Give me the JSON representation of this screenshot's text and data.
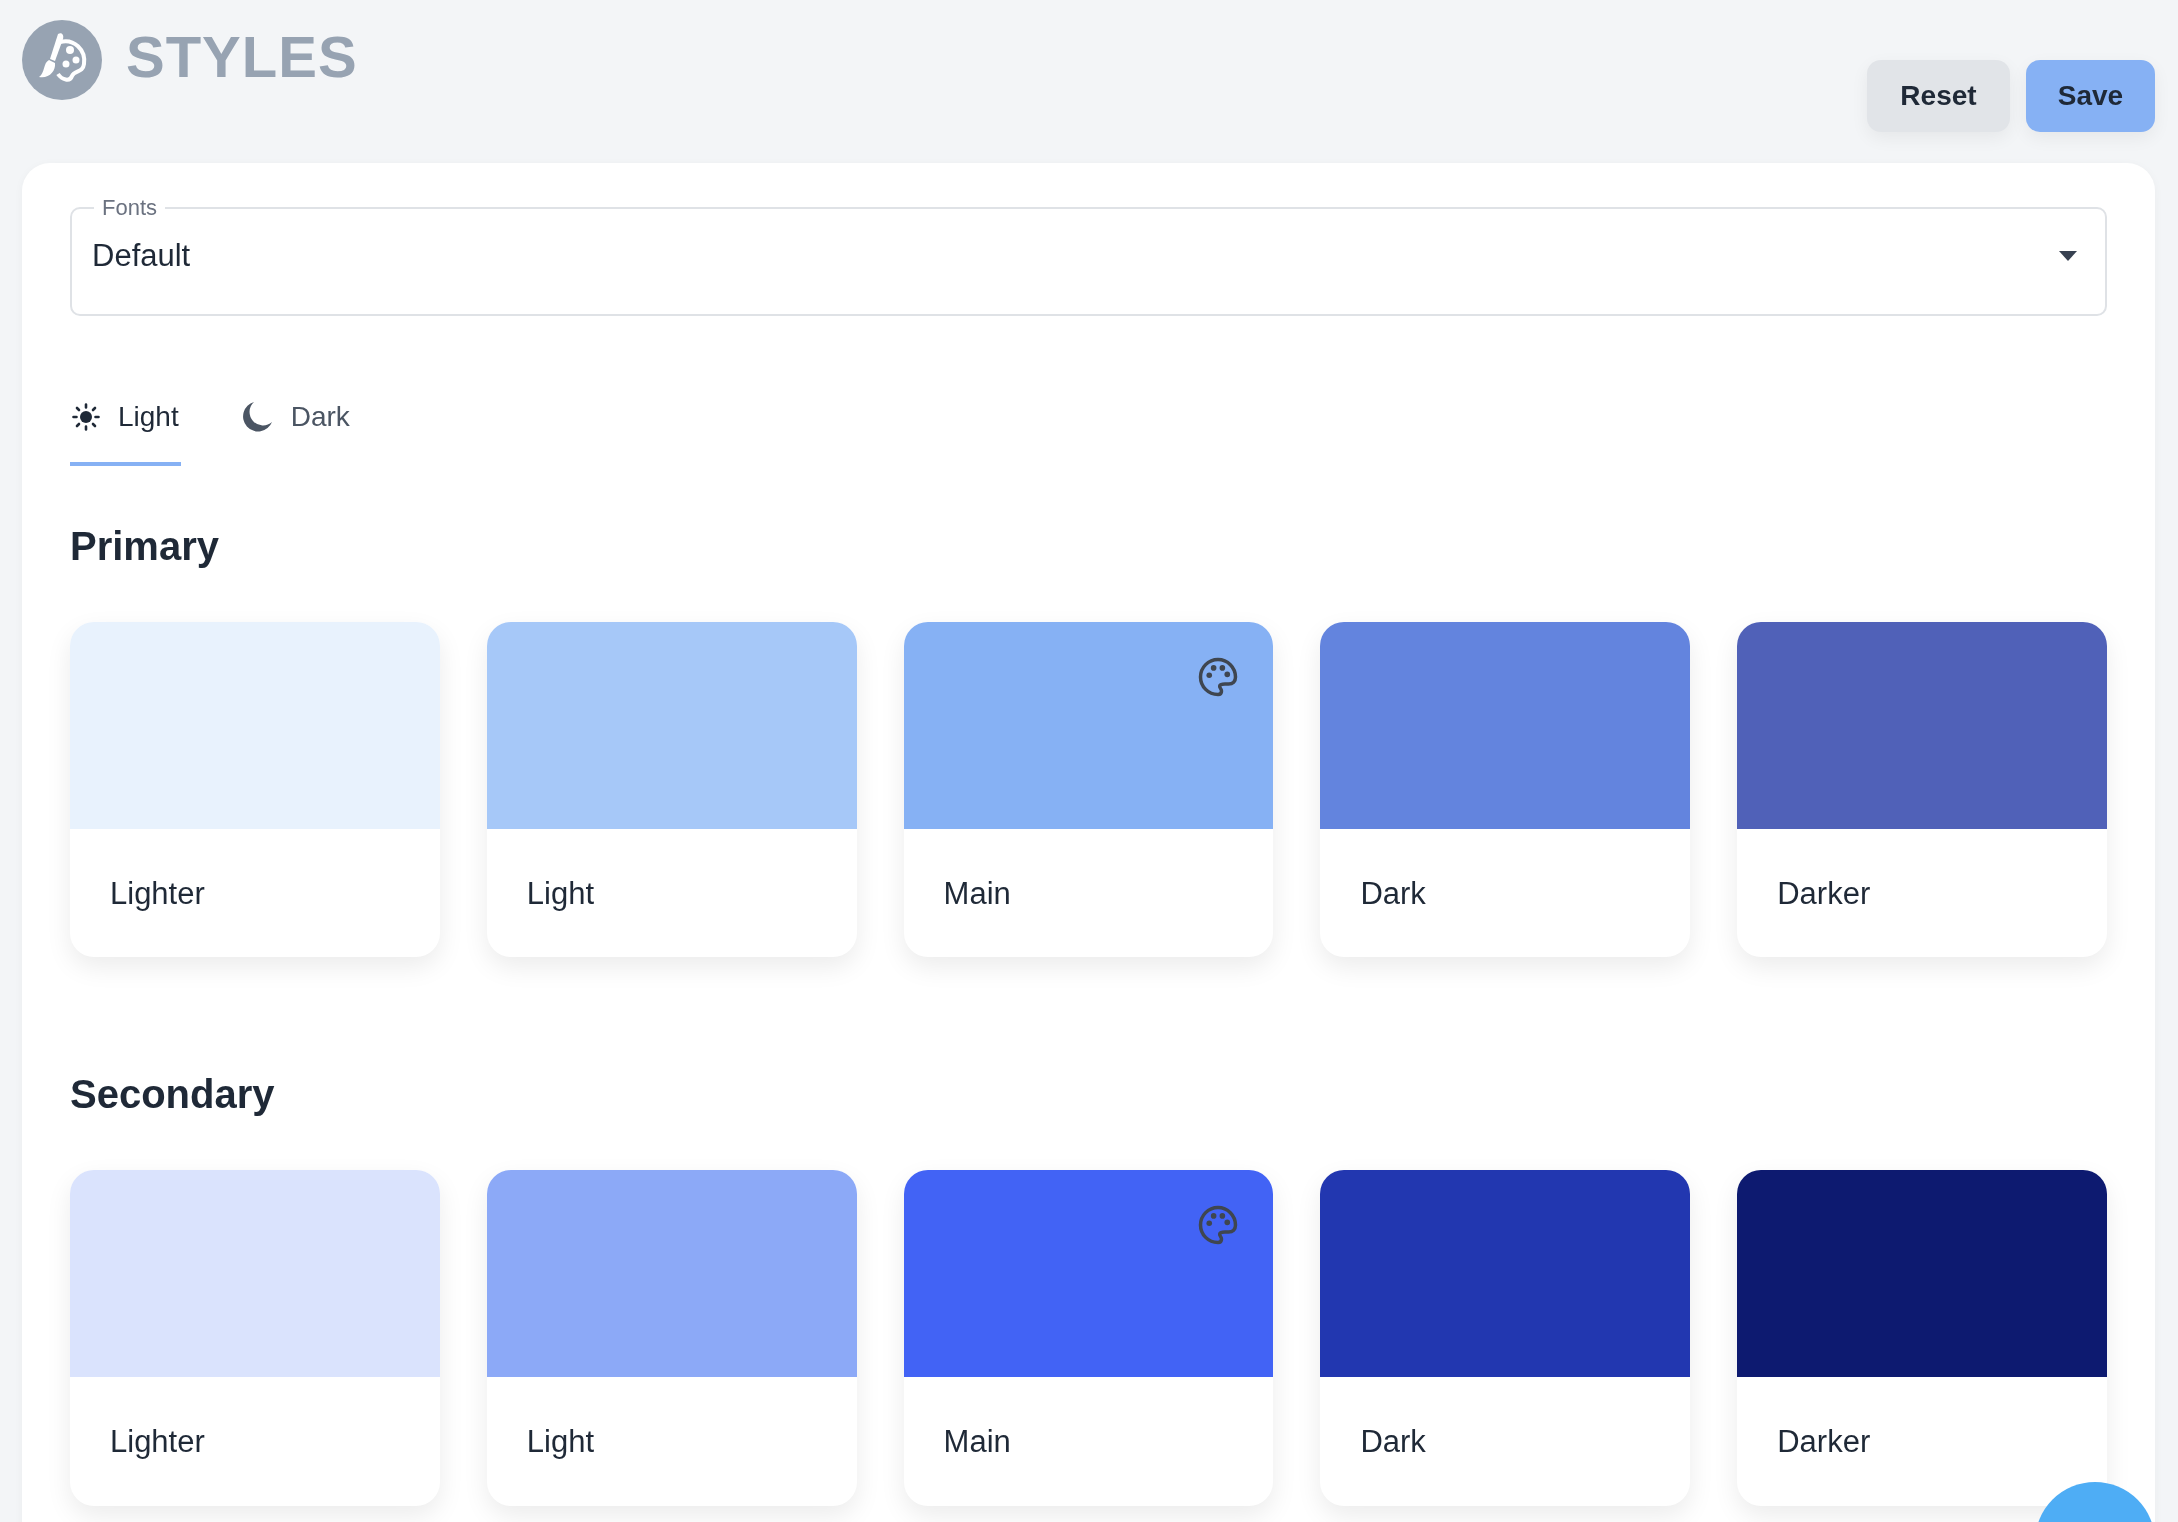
{
  "header": {
    "title": "STYLES"
  },
  "actions": [
    {
      "label": "Reset",
      "kind": "secondary"
    },
    {
      "label": "Save",
      "kind": "primary"
    }
  ],
  "fonts": {
    "label": "Fonts",
    "value": "Default"
  },
  "tabs": [
    {
      "label": "Light",
      "kind": "sun",
      "selected": true
    },
    {
      "label": "Dark",
      "kind": "moon",
      "selected": false
    }
  ],
  "groups": [
    {
      "title": "Primary",
      "swatches": [
        {
          "label": "Lighter",
          "color": "#e8f2fd",
          "selected": false
        },
        {
          "label": "Light",
          "color": "#a6c8f8",
          "selected": false
        },
        {
          "label": "Main",
          "color": "#86b1f4",
          "selected": true
        },
        {
          "label": "Dark",
          "color": "#6384de",
          "selected": false
        },
        {
          "label": "Darker",
          "color": "#5061b8",
          "selected": false
        }
      ]
    },
    {
      "title": "Secondary",
      "swatches": [
        {
          "label": "Lighter",
          "color": "#dae3fd",
          "selected": false
        },
        {
          "label": "Light",
          "color": "#8ca9f7",
          "selected": false
        },
        {
          "label": "Main",
          "color": "#4263f5",
          "selected": true
        },
        {
          "label": "Dark",
          "color": "#2237b0",
          "selected": false
        },
        {
          "label": "Darker",
          "color": "#0d1a70",
          "selected": false
        }
      ]
    }
  ]
}
